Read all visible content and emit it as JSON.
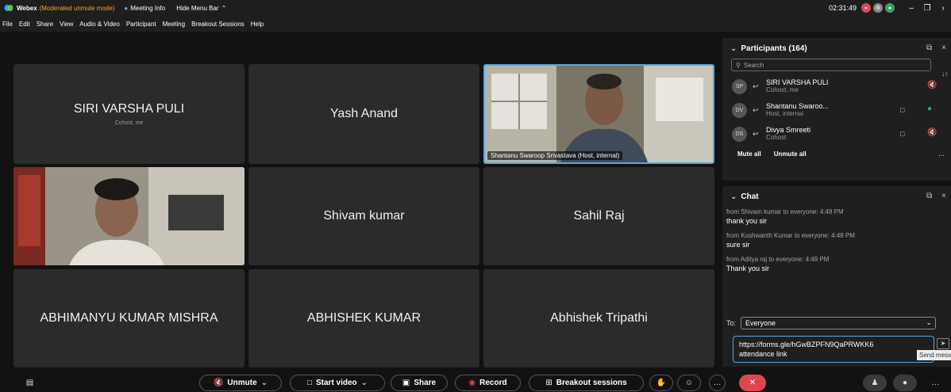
{
  "titlebar": {
    "app": "Webex",
    "mode": "(Moderated unmute mode)",
    "meeting_info": "Meeting Info",
    "hide_menu": "Hide Menu Bar",
    "time": "02:31:49"
  },
  "menu": [
    "File",
    "Edit",
    "Share",
    "View",
    "Audio & Video",
    "Participant",
    "Meeting",
    "Breakout Sessions",
    "Help"
  ],
  "tiles": {
    "t1": {
      "name": "SIRI VARSHA PULI",
      "sub": "Cohost, me"
    },
    "t2": {
      "name": "Yash Anand"
    },
    "t3": {
      "label": "Shantanu Swaroop Srivastava (Host, internal)"
    },
    "t5": {
      "name": "Shivam kumar"
    },
    "t6": {
      "name": "Sahil Raj"
    },
    "t7": {
      "name": "ABHIMANYU KUMAR MISHRA"
    },
    "t8": {
      "name": "ABHISHEK KUMAR"
    },
    "t9": {
      "name": "Abhishek Tripathi"
    }
  },
  "participants": {
    "title": "Participants (164)",
    "search_placeholder": "Search",
    "rows": [
      {
        "initials": "SP",
        "name": "SIRI VARSHA PULI",
        "role": "Cohost, me"
      },
      {
        "initials": "DV",
        "name": "Shantanu Swaroo...",
        "role": "Host, internal"
      },
      {
        "initials": "DS",
        "name": "Divya Smreeti",
        "role": "Cohost"
      }
    ],
    "mute_all": "Mute all",
    "unmute_all": "Unmute all"
  },
  "chat": {
    "title": "Chat",
    "messages": [
      {
        "meta": "from Shivam kumar to everyone:   4:48 PM",
        "text": "thank you sir"
      },
      {
        "meta": "from Kushwanth Kumar to everyone:   4:48 PM",
        "text": "sure sir"
      },
      {
        "meta": "from Aditya raj to everyone:   4:49 PM",
        "text": "Thank you sir"
      }
    ],
    "to_label": "To:",
    "to_value": "Everyone",
    "compose_line1": "https://forms.gle/hGwBZPFN9QaPRWKK6",
    "compose_line2": "attendance link",
    "send_tooltip": "Send message"
  },
  "toolbar": {
    "unmute": "Unmute",
    "start_video": "Start video",
    "share": "Share",
    "record": "Record",
    "breakout": "Breakout sessions"
  },
  "colors": {
    "accent": "#5aa7e0",
    "red": "#e0474c",
    "orange": "#f5a623"
  }
}
